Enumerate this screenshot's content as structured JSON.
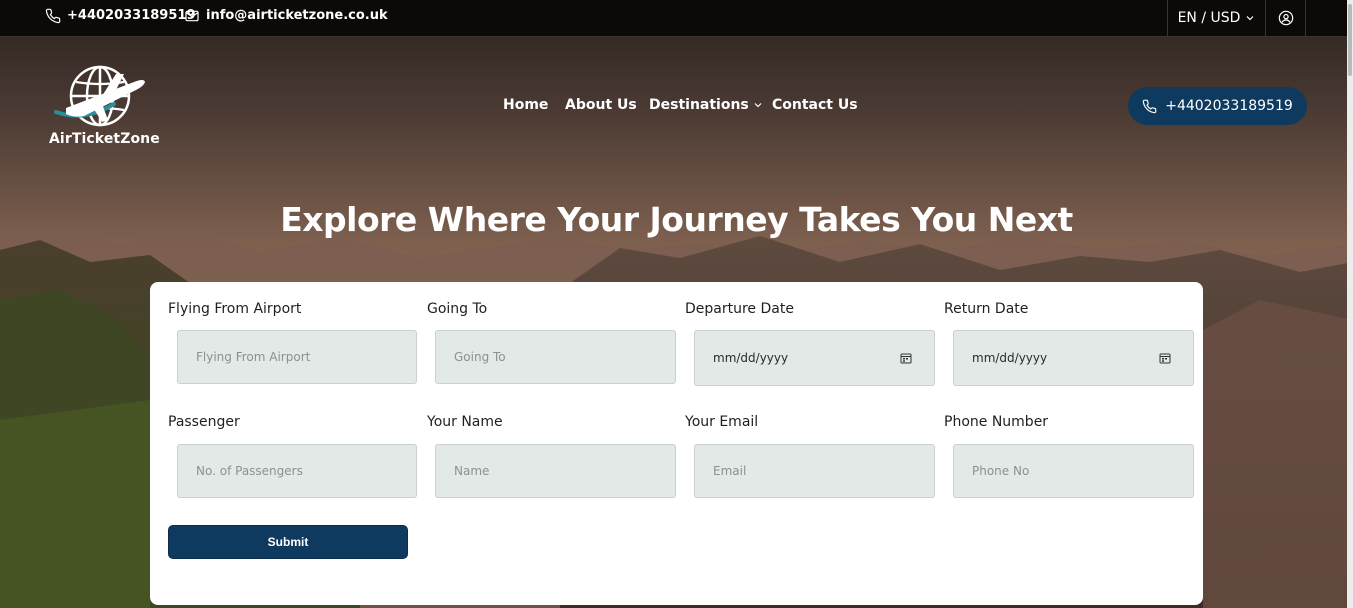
{
  "topbar": {
    "phone": "+4402033189519",
    "email": "info@airticketzone.co.uk",
    "currency": "EN / USD"
  },
  "brand": {
    "name": "AirTicketZone"
  },
  "nav": {
    "items": [
      "Home",
      "About Us",
      "Destinations",
      "Contact Us"
    ]
  },
  "cta": {
    "phone": "+4402033189519"
  },
  "hero": {
    "title": "Explore Where Your Journey Takes You Next"
  },
  "form": {
    "fields": [
      {
        "label": "Flying From Airport",
        "placeholder": "Flying From Airport"
      },
      {
        "label": "Going To",
        "placeholder": "Going To"
      },
      {
        "label": "Departure Date",
        "value": "mm/dd/yyyy"
      },
      {
        "label": "Return Date",
        "value": "mm/dd/yyyy"
      },
      {
        "label": "Passenger",
        "placeholder": "No. of Passengers"
      },
      {
        "label": "Your Name",
        "placeholder": "Name"
      },
      {
        "label": "Your Email",
        "placeholder": "Email"
      },
      {
        "label": "Phone Number",
        "placeholder": "Phone No"
      }
    ],
    "submit_label": "Submit"
  },
  "colors": {
    "accent": "#0e3a5f",
    "field_bg": "#e3e9e6",
    "topbar_bg": "#0c0a09"
  },
  "icons": [
    "phone-icon",
    "mail-icon",
    "chevron-down-icon",
    "user-circle-icon",
    "globe-plane-logo",
    "calendar-icon"
  ]
}
